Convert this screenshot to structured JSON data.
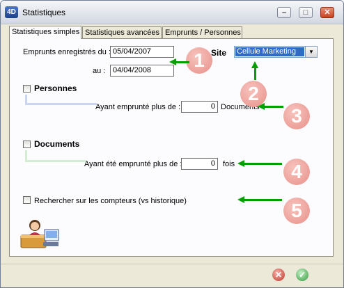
{
  "window": {
    "title": "Statistiques",
    "logo": "4D",
    "controls": {
      "minimize": "–",
      "maximize": "□",
      "close": "✕"
    }
  },
  "tabs": [
    {
      "label": "Statistiques simples",
      "active": true
    },
    {
      "label": "Statistiques avancées",
      "active": false
    },
    {
      "label": "Emprunts / Personnes",
      "active": false
    }
  ],
  "form": {
    "from_label": "Emprunts enregistrés du :",
    "from_value": "05/04/2007",
    "to_label": "au :",
    "to_value": "04/04/2008",
    "site_label": "Site",
    "site_value": "Cellule Marketing",
    "personnes_label": "Personnes",
    "personnes_checked": false,
    "personnes_sub_label": "Ayant emprunté plus de :",
    "personnes_value": "0",
    "personnes_unit": "Documents",
    "documents_label": "Documents",
    "documents_checked": false,
    "documents_sub_label": "Ayant été emprunté plus de :",
    "documents_value": "0",
    "documents_unit": "fois",
    "compteurs_label": "Rechercher sur les compteurs (vs historique)",
    "compteurs_checked": false
  },
  "annotations": [
    "1",
    "2",
    "3",
    "4",
    "5"
  ],
  "icons": {
    "illustration": "librarian-desk-icon",
    "cancel": "cancel-x-icon",
    "ok": "ok-check-icon"
  },
  "colors": {
    "badge": "#e8908a",
    "arrow": "#00a000",
    "selection": "#316ac5"
  }
}
